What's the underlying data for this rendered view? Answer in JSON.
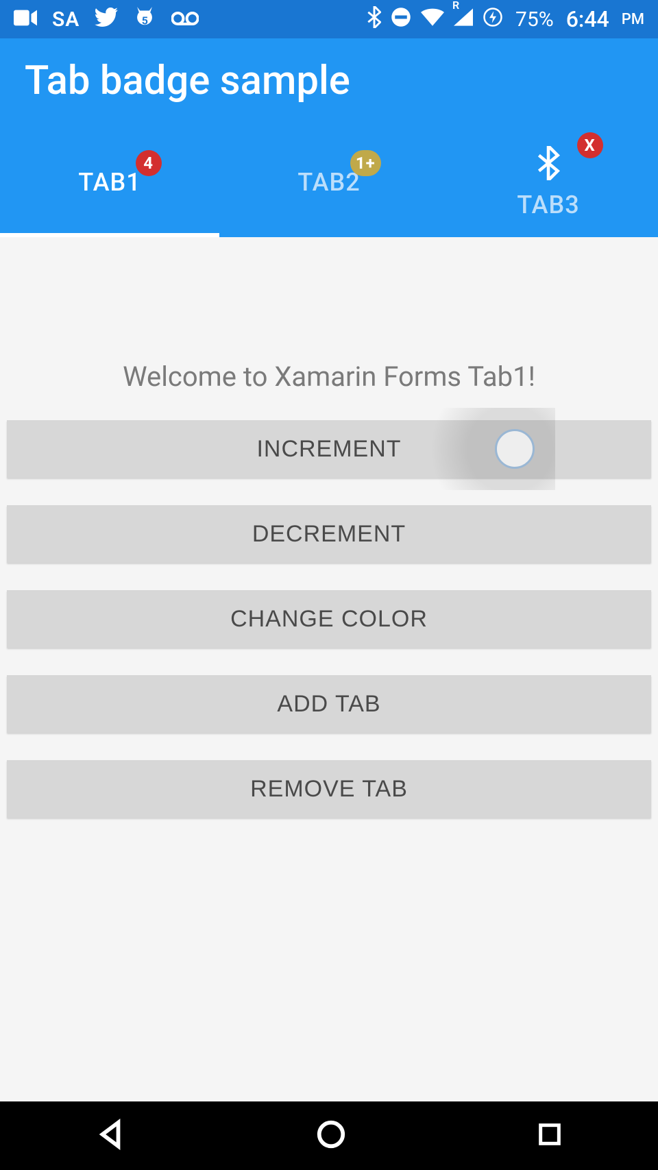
{
  "status": {
    "sa": "SA",
    "notif_badge": "5",
    "battery": "75%",
    "time": "6:44",
    "ampm": "PM",
    "signal_r": "R"
  },
  "app": {
    "title": "Tab badge sample"
  },
  "tabs": [
    {
      "label": "TAB1",
      "badge": "4",
      "selected": true
    },
    {
      "label": "TAB2",
      "badge": "1+",
      "selected": false
    },
    {
      "label": "TAB3",
      "badge": "X",
      "selected": false
    }
  ],
  "main": {
    "welcome": "Welcome to Xamarin Forms Tab1!",
    "buttons": {
      "increment": "INCREMENT",
      "decrement": "DECREMENT",
      "change_color": "CHANGE COLOR",
      "add_tab": "ADD TAB",
      "remove_tab": "REMOVE TAB"
    }
  }
}
